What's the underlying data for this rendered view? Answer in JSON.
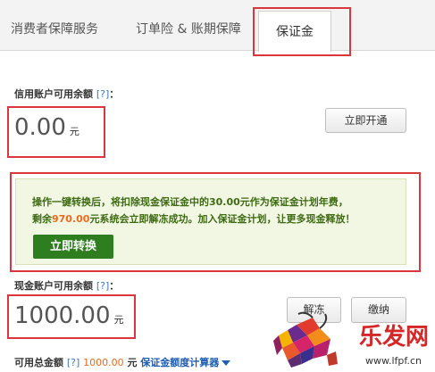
{
  "tabs": [
    "消费者保障服务",
    "订单险 & 账期保障",
    "保证金"
  ],
  "credit": {
    "label": "信用账户可用余额",
    "help": "[?]",
    "colon": "：",
    "value": "0.00",
    "unit": "元",
    "open_button": "立即开通"
  },
  "notice": {
    "line1_prefix": "操作一键转换后，将扣除现金保证金中的30.00元作为保证金计划年费，",
    "line2_prefix": "剩余",
    "line2_amount": "970.00",
    "line2_suffix": "元系统会立即解冻成功。加入保证金计划，让更多现金释放！",
    "convert_button": "立即转换"
  },
  "cash": {
    "label": "现金账户可用余额",
    "help": "[?]",
    "colon": "：",
    "value": "1000.00",
    "unit": "元",
    "unfreeze_button": "解冻",
    "pay_button": "缴纳"
  },
  "total": {
    "label": "可用总金额",
    "help": "[?]",
    "amount": "1000.00",
    "unit": "元",
    "calculator_link": "保证金额度计算器"
  },
  "watermark": {
    "brand": "乐发网",
    "url": "www.lfpf.cn"
  },
  "colors": {
    "highlight_box": "#d9363e",
    "green_button": "#2e7d1e",
    "amount_orange": "#e86b1e",
    "link_blue": "#1e5db2"
  }
}
